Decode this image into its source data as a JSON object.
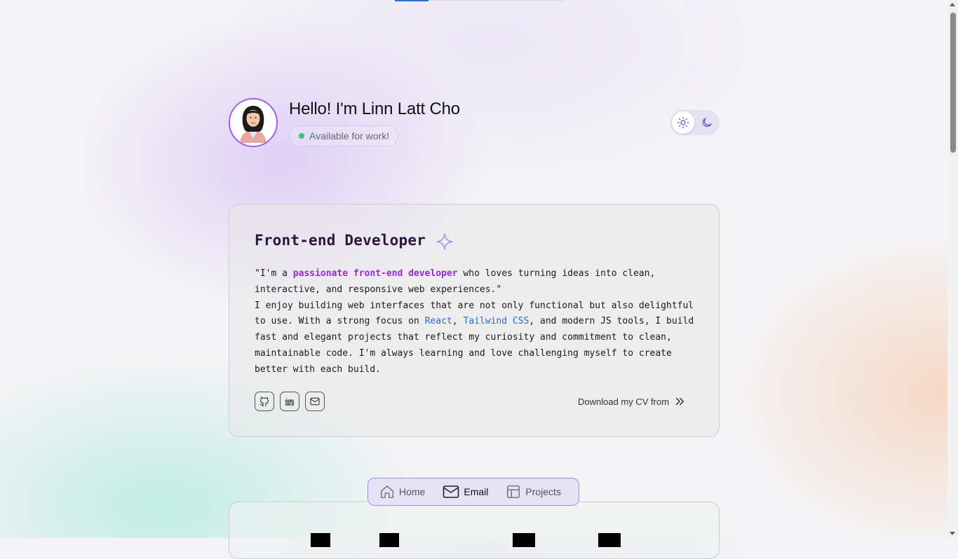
{
  "profile": {
    "greeting": "Hello! I'm Linn Latt Cho",
    "status": "Available for work!"
  },
  "theme_toggle": {
    "light": "sun-icon",
    "dark": "moon-icon"
  },
  "about": {
    "title": "Front-end Developer",
    "quote_open": "\"I'm a ",
    "quote_highlight": "passionate front-end developer",
    "quote_rest": " who loves turning ideas into clean, interactive, and responsive web experiences.\"",
    "body_1": "I enjoy building web interfaces that are not only functional but also delightful to use. With a strong focus on ",
    "tech_1": "React",
    "sep": ", ",
    "tech_2": "Tailwind CSS",
    "body_2": ", and modern JS tools, I build fast and elegant projects that reflect my curiosity and commitment to clean, maintainable code. I'm always learning and love challenging myself to create better with each build.",
    "socials": [
      "github-icon",
      "linkedin-icon",
      "mail-icon"
    ],
    "cv_label": "Download my CV from"
  },
  "nav": {
    "items": [
      {
        "label": "Home",
        "icon": "home-icon"
      },
      {
        "label": "Email",
        "icon": "mail-icon",
        "active": true
      },
      {
        "label": "Projects",
        "icon": "layout-icon"
      }
    ]
  },
  "colors": {
    "accent": "#9b27d6",
    "link": "#2a6ad6",
    "status": "#3ec27a"
  }
}
